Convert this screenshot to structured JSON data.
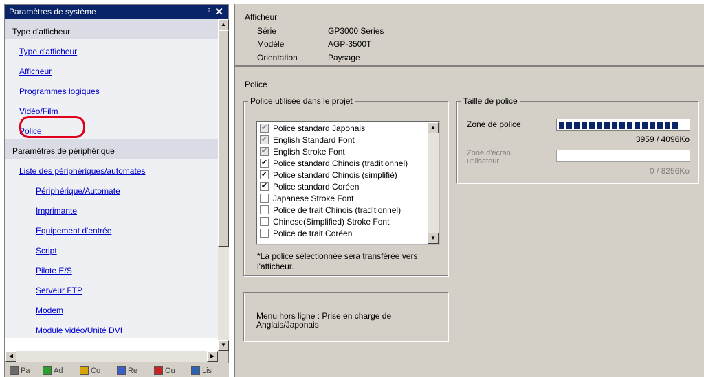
{
  "left_panel": {
    "title": "Paramètres de système",
    "pin_glyph": "ᵖ",
    "close_glyph": "✕",
    "sections": [
      {
        "label": "Type d'afficheur",
        "items": [
          {
            "label": "Type d'afficheur",
            "sub": false
          },
          {
            "label": "Afficheur",
            "sub": false
          },
          {
            "label": "Programmes logiques",
            "sub": false
          },
          {
            "label": "Vidéo/Film",
            "sub": false
          },
          {
            "label": "Police",
            "sub": false
          }
        ]
      },
      {
        "label": "Paramètres de périphérique",
        "items": [
          {
            "label": "Liste des périphériques/automates",
            "sub": false
          },
          {
            "label": "Périphérique/Automate",
            "sub": true
          },
          {
            "label": "Imprimante",
            "sub": true
          },
          {
            "label": "Equipement d'entrée",
            "sub": true
          },
          {
            "label": "Script",
            "sub": true
          },
          {
            "label": "Pilote E/S",
            "sub": true
          },
          {
            "label": "Serveur FTP",
            "sub": true
          },
          {
            "label": "Modem",
            "sub": true
          },
          {
            "label": "Module vidéo/Unité DVI",
            "sub": true
          }
        ]
      }
    ],
    "tabs": [
      {
        "label": "Pa",
        "icon": "system-settings-icon",
        "color": "#6b6b6b"
      },
      {
        "label": "Ad",
        "icon": "address-icon",
        "color": "#2aa02a"
      },
      {
        "label": "Co",
        "icon": "color-palette-icon",
        "color": "#d9a400"
      },
      {
        "label": "Re",
        "icon": "search-icon",
        "color": "#3a5fcd"
      },
      {
        "label": "Ou",
        "icon": "tools-icon",
        "color": "#cc2222"
      },
      {
        "label": "Lis",
        "icon": "list-icon",
        "color": "#2d63b5"
      }
    ]
  },
  "info": {
    "header": "Afficheur",
    "rows": [
      {
        "label": "Série",
        "value": "GP3000 Series"
      },
      {
        "label": "Modèle",
        "value": "AGP-3500T"
      },
      {
        "label": "Orientation",
        "value": "Paysage"
      }
    ]
  },
  "police": {
    "title": "Police",
    "fonts_group_label": "Police utilisée dans le projet",
    "fonts": [
      {
        "label": "Police standard Japonais",
        "checked": true,
        "disabled": true
      },
      {
        "label": "English Standard Font",
        "checked": true,
        "disabled": true
      },
      {
        "label": "English Stroke Font",
        "checked": true,
        "disabled": true
      },
      {
        "label": "Police standard Chinois (traditionnel)",
        "checked": true,
        "disabled": false
      },
      {
        "label": "Police standard Chinois (simplifié)",
        "checked": true,
        "disabled": false
      },
      {
        "label": "Police standard Coréen",
        "checked": true,
        "disabled": false
      },
      {
        "label": "Japanese Stroke Font",
        "checked": false,
        "disabled": false
      },
      {
        "label": "Police de trait Chinois (traditionnel)",
        "checked": false,
        "disabled": false
      },
      {
        "label": "Chinese(Simplified) Stroke Font",
        "checked": false,
        "disabled": false
      },
      {
        "label": "Police de trait Coréen",
        "checked": false,
        "disabled": false
      }
    ],
    "note": "*La police sélectionnée sera transférée vers l'afficheur.",
    "size_group_label": "Taille de police",
    "font_zone_label": "Zone de police",
    "font_zone_usage": "3959 / 4096Ko",
    "font_zone_fill": 0.97,
    "user_zone_label": "Zone d'écran utilisateur",
    "user_zone_usage": "0 / 8256Ko",
    "user_zone_fill": 0,
    "offline_menu_note": "Menu hors ligne : Prise en charge de Anglais/Japonais"
  }
}
